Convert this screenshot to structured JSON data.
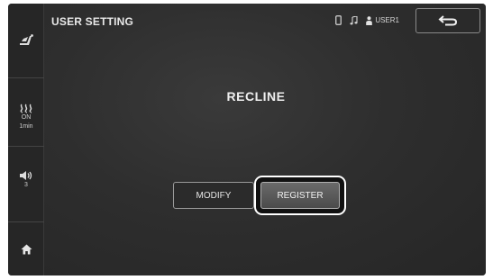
{
  "header": {
    "title": "USER SETTING",
    "user": "USER1"
  },
  "sidebar": {
    "heat": {
      "status": "ON",
      "timer": "1min"
    },
    "volume": {
      "level": "3"
    }
  },
  "main": {
    "title": "RECLINE",
    "modify_label": "MODIFY",
    "register_label": "REGISTER"
  },
  "icons": {
    "sidebar_top": "recline-chair-icon",
    "heat": "heat-waves-icon",
    "volume": "speaker-icon",
    "home": "home-icon",
    "phone": "phone-icon",
    "music": "music-note-icon",
    "user": "person-icon",
    "back": "return-arrow-icon"
  },
  "colors": {
    "background": "#2c2c2c",
    "text": "#e8e8e8",
    "highlight_ring": "#ffffff"
  }
}
